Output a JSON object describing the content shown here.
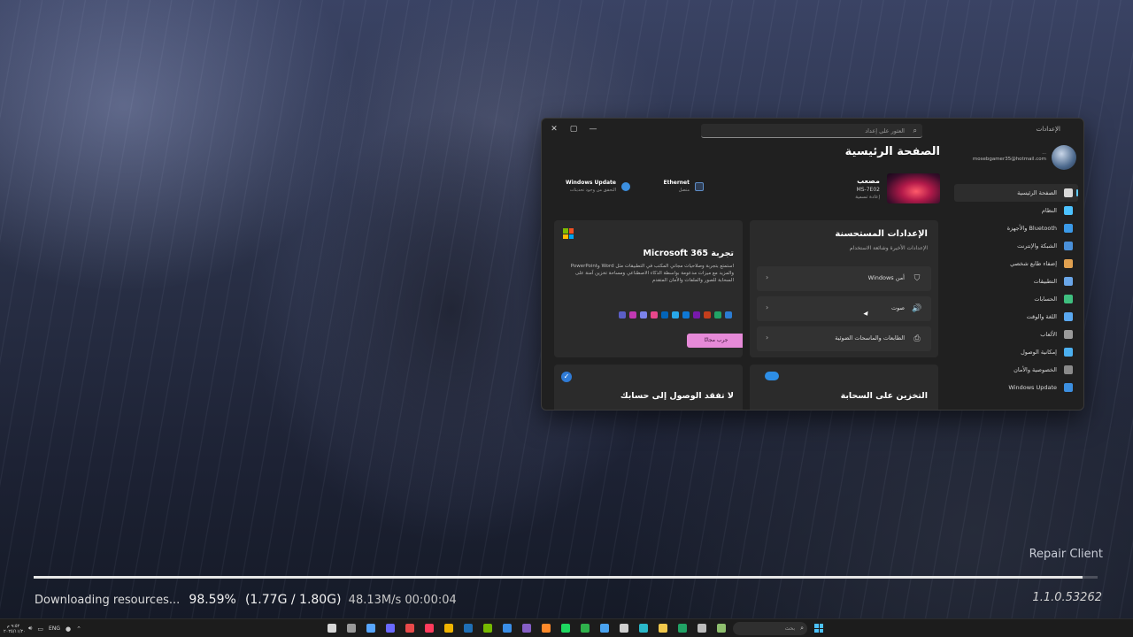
{
  "settings": {
    "app_title": "الإعدادات",
    "search_placeholder": "العثور على إعداد",
    "page_title": "الصفحة الرئيسية",
    "account": {
      "name": "...",
      "email": "mosebgamer35@hotmail.com"
    },
    "nav": [
      {
        "label": "الصفحة الرئيسية",
        "icon": "home-icon",
        "color": "#d9d9d9",
        "active": true
      },
      {
        "label": "النظام",
        "icon": "system-icon",
        "color": "#4cc2ff"
      },
      {
        "label": "Bluetooth والأجهزة",
        "icon": "bluetooth-icon",
        "color": "#3b9ae8"
      },
      {
        "label": "الشبكة والإنترنت",
        "icon": "network-icon",
        "color": "#4a90d9"
      },
      {
        "label": "إضفاء طابع شخصي",
        "icon": "brush-icon",
        "color": "#e0a050"
      },
      {
        "label": "التطبيقات",
        "icon": "apps-icon",
        "color": "#6aa6e8"
      },
      {
        "label": "الحسابات",
        "icon": "accounts-icon",
        "color": "#3fbf7f"
      },
      {
        "label": "اللغة والوقت",
        "icon": "time-language-icon",
        "color": "#5aa8f0"
      },
      {
        "label": "الألعاب",
        "icon": "gaming-icon",
        "color": "#9a9a9a"
      },
      {
        "label": "إمكانية الوصول",
        "icon": "accessibility-icon",
        "color": "#4cb0f0"
      },
      {
        "label": "الخصوصية والأمان",
        "icon": "privacy-icon",
        "color": "#8a8a8a"
      },
      {
        "label": "Windows Update",
        "icon": "windows-update-icon",
        "color": "#3c8fe0"
      }
    ],
    "device": {
      "name": "مصعب",
      "model": "MS-7E02",
      "rename": "إعادة تسمية"
    },
    "status": {
      "ethernet": {
        "title": "Ethernet",
        "sub": "متصل"
      },
      "update": {
        "title": "Windows Update",
        "sub": "التحقق من وجود تحديثات"
      }
    },
    "recommended": {
      "title": "الإعدادات المستحسنة",
      "subtitle": "الإعدادات الأخيرة وشائعة الاستخدام",
      "items": [
        {
          "label": "أمن Windows",
          "icon": "shield-icon",
          "glyph": "⛉"
        },
        {
          "label": "صوت",
          "icon": "speaker-icon",
          "glyph": "🔊"
        },
        {
          "label": "الطابعات والماسحات الضوئية",
          "icon": "printer-icon",
          "glyph": "⎙"
        }
      ]
    },
    "m365": {
      "title": "تجربة Microsoft 365",
      "desc": "استمتع بتجربة وصلاحيات مجاني المكتب في التطبيقات مثل Word وPowerPoint والمزيد مع ميزات مدعومة بواسطة الذكاء الاصطناعي ومساحة تخزين آمنة على السحابة للصور والملفات والأمان المتقدم",
      "button": "جرب مجانًا",
      "app_colors": [
        "#2b7cd3",
        "#21a366",
        "#c43e1c",
        "#7719aa",
        "#0f78d4",
        "#28a8ea",
        "#0364b8",
        "#e8478b",
        "#7b83eb",
        "#c239b3",
        "#5b5fc7"
      ]
    },
    "cloud": {
      "title": "التخزين على السحابة"
    },
    "account_card": {
      "title": "لا تفقد الوصول إلى حسابك"
    }
  },
  "launcher": {
    "repair_label": "Repair Client",
    "status_text": "Downloading resources...",
    "percent_text": "98.59%",
    "size_text": "(1.77G / 1.80G)",
    "speed_text": "48.13M/s 00:00:04",
    "progress": 0.9859,
    "version": "1.1.0.53262"
  },
  "taskbar": {
    "time": "٩:٥٢ م",
    "date": "٢٠٢٥/١١/٢٠",
    "lang": "ENG",
    "search_placeholder": "بحث",
    "apps": [
      {
        "name": "game-launcher-icon",
        "color": "#d7d7d7"
      },
      {
        "name": "settings-app-icon",
        "color": "#9a9a9a"
      },
      {
        "name": "store-app-icon",
        "color": "#58a6ff"
      },
      {
        "name": "discord-like-icon",
        "color": "#6a6aff"
      },
      {
        "name": "browser-icon",
        "color": "#e94a4a"
      },
      {
        "name": "opera-icon",
        "color": "#ff3b5c"
      },
      {
        "name": "chrome-icon",
        "color": "#f0b400"
      },
      {
        "name": "steam-icon",
        "color": "#1f6fb5"
      },
      {
        "name": "nvidia-icon",
        "color": "#76b900"
      },
      {
        "name": "mail-icon",
        "color": "#3a8ee6"
      },
      {
        "name": "visual-studio-icon",
        "color": "#865fc5"
      },
      {
        "name": "firefox-icon",
        "color": "#ff8a2b"
      },
      {
        "name": "spotify-icon",
        "color": "#1ed760"
      },
      {
        "name": "xbox-icon",
        "color": "#2fb24c"
      },
      {
        "name": "cloud-app-icon",
        "color": "#4aa3f0"
      },
      {
        "name": "photos-icon",
        "color": "#cfcfcf"
      },
      {
        "name": "edge-icon",
        "color": "#2ab8c9"
      },
      {
        "name": "file-explorer-icon",
        "color": "#f2c94c"
      },
      {
        "name": "excel-icon",
        "color": "#21a366"
      },
      {
        "name": "notepad-icon",
        "color": "#bdbdbd"
      },
      {
        "name": "widgets-icon",
        "color": "#8fbf6f"
      }
    ]
  }
}
